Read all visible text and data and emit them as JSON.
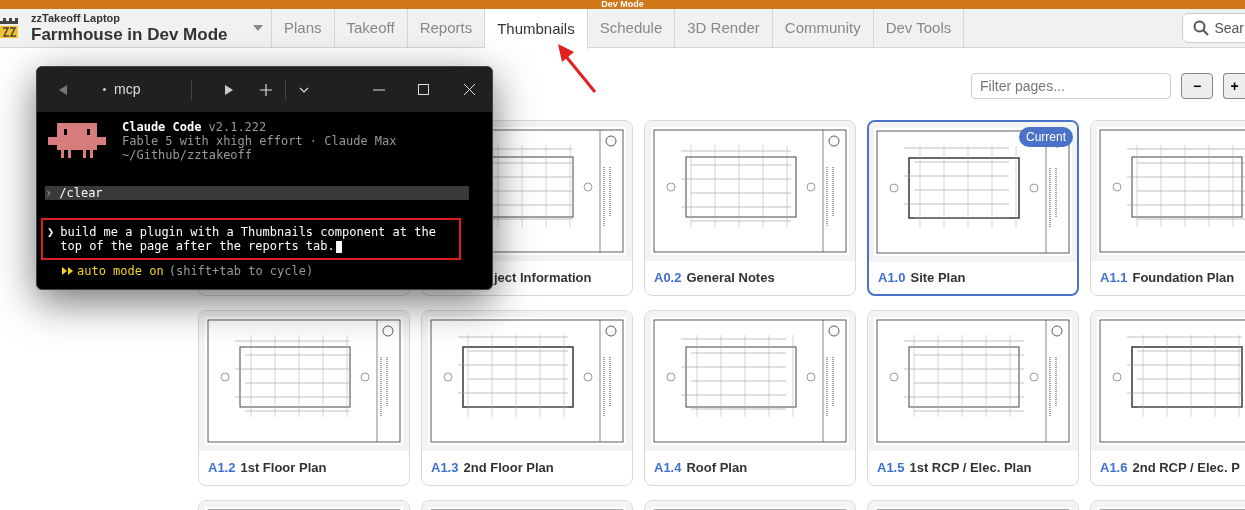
{
  "banner": {
    "title": "Dev Mode"
  },
  "project": {
    "workspace": "zzTakeoff Laptop",
    "name": "Farmhouse in Dev Mode"
  },
  "tabs": [
    {
      "label": "Plans",
      "selected": false
    },
    {
      "label": "Takeoff",
      "selected": false
    },
    {
      "label": "Reports",
      "selected": false
    },
    {
      "label": "Thumbnails",
      "selected": true
    },
    {
      "label": "Schedule",
      "selected": false
    },
    {
      "label": "3D Render",
      "selected": false
    },
    {
      "label": "Community",
      "selected": false
    },
    {
      "label": "Dev Tools",
      "selected": false
    }
  ],
  "search": {
    "label": "Sear"
  },
  "toolbar": {
    "filter_placeholder": "Filter pages...",
    "zoom_out": "−",
    "zoom_in": "+"
  },
  "cards": [
    {
      "kind": "covered",
      "selected": false
    },
    {
      "kind": "page",
      "title": "ject Information",
      "selected": false
    },
    {
      "kind": "page",
      "code": "A0.2",
      "title": "General Notes",
      "selected": false
    },
    {
      "kind": "page",
      "code": "A1.0",
      "title": "Site Plan",
      "selected": true,
      "badge": "Current"
    },
    {
      "kind": "page",
      "code": "A1.1",
      "title": "Foundation Plan",
      "selected": false
    },
    {
      "kind": "page",
      "code": "A1.2",
      "title": "1st Floor Plan",
      "selected": false
    },
    {
      "kind": "page",
      "code": "A1.3",
      "title": "2nd Floor Plan",
      "selected": false
    },
    {
      "kind": "page",
      "code": "A1.4",
      "title": "Roof Plan",
      "selected": false
    },
    {
      "kind": "page",
      "code": "A1.5",
      "title": "1st RCP / Elec. Plan",
      "selected": false
    },
    {
      "kind": "page",
      "code": "A1.6",
      "title": "2nd RCP / Elec. P",
      "selected": false
    },
    {
      "kind": "page",
      "selected": false
    },
    {
      "kind": "page",
      "selected": false
    },
    {
      "kind": "page",
      "selected": false
    },
    {
      "kind": "page",
      "selected": false
    },
    {
      "kind": "page",
      "selected": false
    }
  ],
  "terminal": {
    "tab": "mcp",
    "app_name": "Claude Code",
    "version": "v2.1.222",
    "model_line": "Fable 5 with xhigh effort · Claude Max",
    "path": "~/Github/zztakeoff",
    "history_marker": "›",
    "history": "/clear",
    "prompt_marker": "❯",
    "prompt": "build me a plugin with a Thumbnails component at the top of the page after the reports tab.",
    "mode": "auto mode on",
    "mode_hint": "(shift+tab to cycle)"
  }
}
